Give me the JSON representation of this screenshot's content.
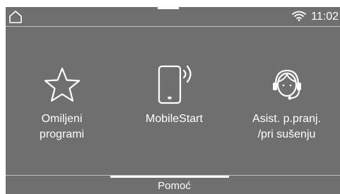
{
  "status": {
    "time": "11:02",
    "home_icon": "home-icon",
    "wifi_icon": "wifi-icon"
  },
  "tiles": [
    {
      "icon": "star-icon",
      "line1": "Omiljeni",
      "line2": "programi"
    },
    {
      "icon": "mobile-start-icon",
      "line1": "MobileStart",
      "line2": ""
    },
    {
      "icon": "headset-assistant-icon",
      "line1": "Asist. p.pranj.",
      "line2": "/pri sušenju"
    }
  ],
  "footer": {
    "help_label": "Pomoć"
  },
  "colors": {
    "background": "#6f6f6f",
    "foreground": "#ffffff",
    "divider": "#bdbdbd"
  }
}
